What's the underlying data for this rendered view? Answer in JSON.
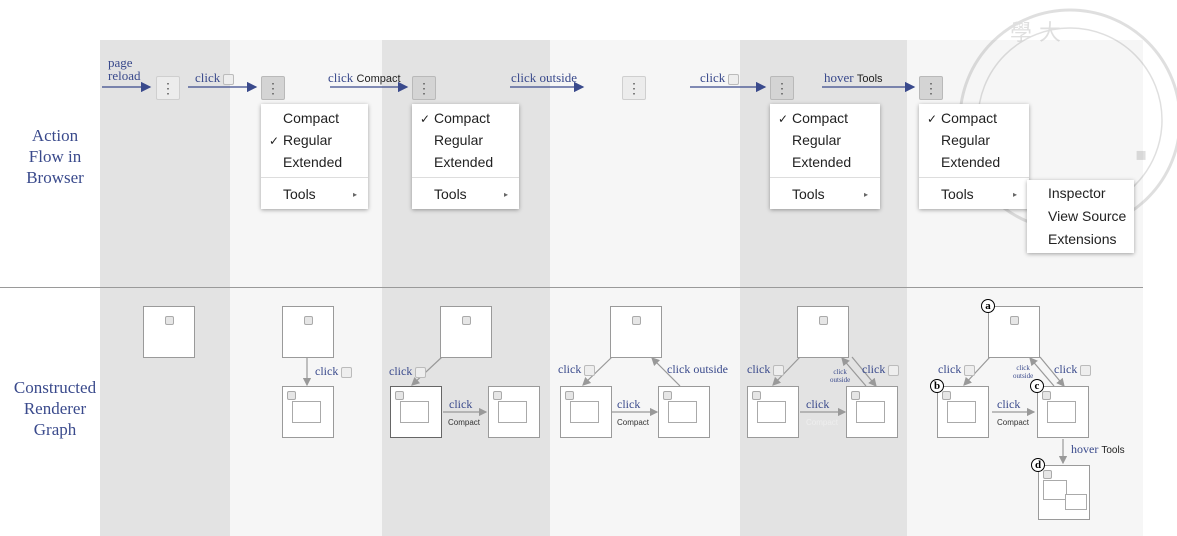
{
  "row_labels": {
    "top": [
      "Action",
      "Flow in",
      "Browser"
    ],
    "bottom": [
      "Constructed",
      "Renderer",
      "Graph"
    ]
  },
  "kebab_glyph": "⋮",
  "check_glyph": "✓",
  "submenu_glyph": "▸",
  "actions": {
    "a1_line1": "page",
    "a1_line2": "reload",
    "a2": "click",
    "a3_word": "click",
    "a3_target": "Compact",
    "a4": "click outside",
    "a5": "click",
    "a6_word": "hover",
    "a6_target": "Tools"
  },
  "menu": {
    "items": [
      "Compact",
      "Regular",
      "Extended"
    ],
    "tools": "Tools",
    "submenu": [
      "Inspector",
      "View Source",
      "Extensions"
    ]
  },
  "graph": {
    "click": "click",
    "click_outside": "click outside",
    "click_outside_small_1": "click",
    "click_outside_small_2": "outside",
    "compact": "Compact",
    "hover": "hover",
    "tools": "Tools",
    "node_labels": [
      "a",
      "b",
      "c",
      "d"
    ]
  },
  "colors": {
    "annotation": "#3a4a8c",
    "column_shade": "#e3e3e3",
    "column_light": "#f6f6f6"
  }
}
